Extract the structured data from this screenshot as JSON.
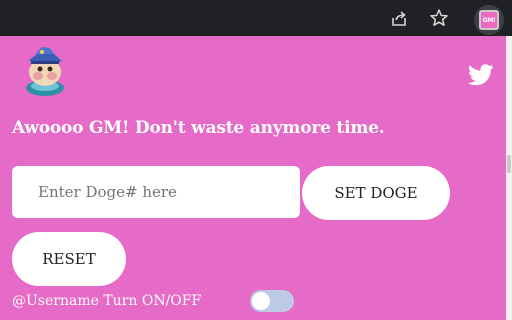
{
  "browser": {
    "toolbar_icons": [
      "share-icon",
      "star-icon"
    ],
    "extension_icon_text": "GM!"
  },
  "popup": {
    "logo": "doge-logo-icon",
    "social_icon": "twitter-icon",
    "headline": "Awoooo GM! Don't waste anymore time.",
    "input": {
      "placeholder": "Enter Doge# here",
      "value": ""
    },
    "set_button_label": "SET DOGE",
    "reset_button_label": "RESET",
    "toggle": {
      "label": "@Username Turn ON/OFF",
      "state": "off"
    }
  },
  "colors": {
    "popup_background": "#e66ac7",
    "browser_background": "#202124",
    "toggle_track": "#bfcbe6"
  }
}
